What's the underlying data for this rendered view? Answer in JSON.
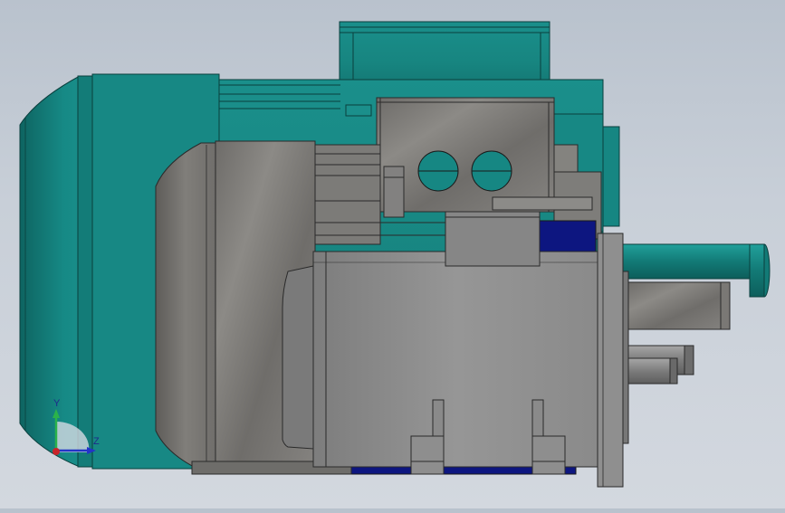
{
  "scene": {
    "model": "motor-assembly",
    "colors": {
      "teal_body": "#178a86",
      "teal_dark": "#0f6664",
      "teal_light": "#2aa7a2",
      "metal_grey": "#8e8e8e",
      "stone_grey": "#7a7a78",
      "navy_accent": "#0d1680",
      "background_top": "#b9c2cd",
      "background_bottom": "#d3d8df"
    }
  },
  "triad": {
    "y_label": "Y",
    "z_label": "Z",
    "y_color": "#2bb24a",
    "z_color": "#2335c8",
    "origin_color": "#c8242a"
  }
}
